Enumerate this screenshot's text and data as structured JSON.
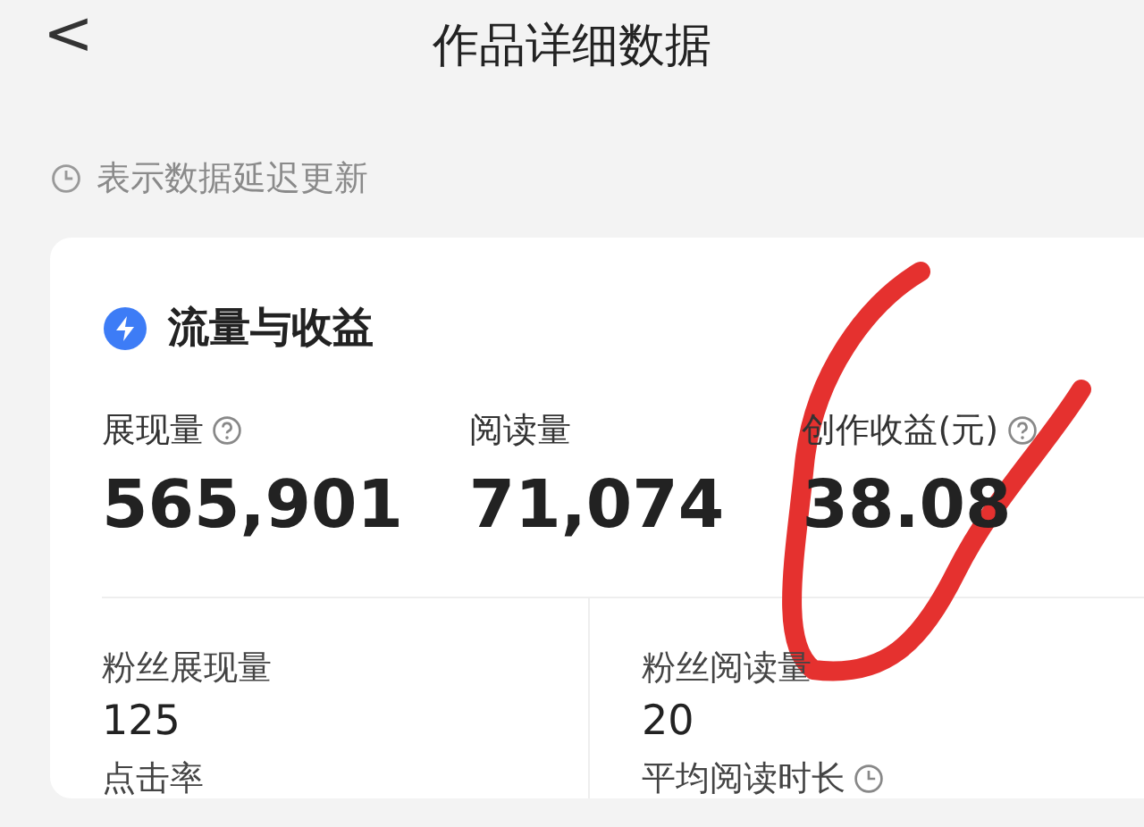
{
  "header": {
    "back": "<",
    "title": "作品详细数据"
  },
  "notice": "表示数据延迟更新",
  "card": {
    "title": "流量与收益",
    "metrics": [
      {
        "label": "展现量",
        "help": true,
        "value": "565,901"
      },
      {
        "label": "阅读量",
        "help": false,
        "value": "71,074"
      },
      {
        "label": "创作收益(元)",
        "help": true,
        "value": "38.08"
      }
    ],
    "stats": [
      {
        "label": "粉丝展现量",
        "value": "125",
        "info": false
      },
      {
        "label": "粉丝阅读量",
        "value": "20",
        "info": false
      },
      {
        "label": "点击率",
        "info": false
      },
      {
        "label": "平均阅读时长",
        "info": true
      }
    ]
  }
}
